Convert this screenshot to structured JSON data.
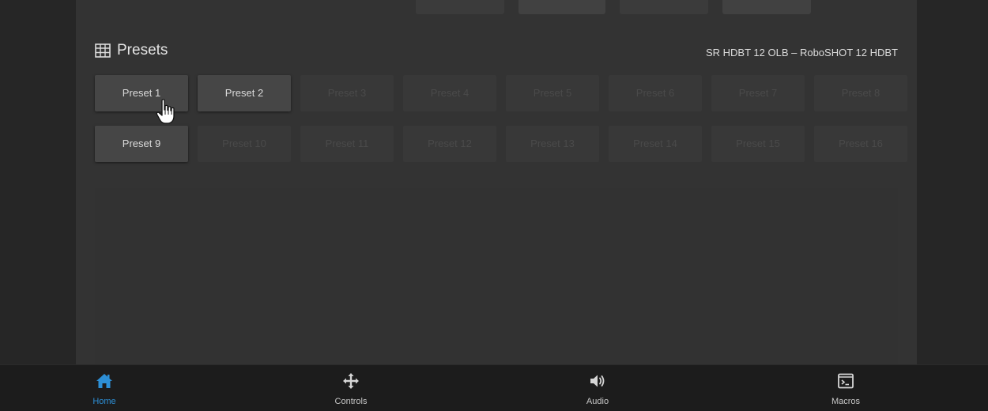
{
  "presets_section": {
    "title": "Presets",
    "camera_name": "SR HDBT 12 OLB – RoboSHOT 12 HDBT",
    "presets": [
      {
        "label": "Preset 1",
        "state": "active"
      },
      {
        "label": "Preset 2",
        "state": "active"
      },
      {
        "label": "Preset 3",
        "state": "inactive"
      },
      {
        "label": "Preset 4",
        "state": "inactive"
      },
      {
        "label": "Preset 5",
        "state": "inactive"
      },
      {
        "label": "Preset 6",
        "state": "inactive"
      },
      {
        "label": "Preset 7",
        "state": "inactive"
      },
      {
        "label": "Preset 8",
        "state": "inactive"
      },
      {
        "label": "Preset 9",
        "state": "active"
      },
      {
        "label": "Preset 10",
        "state": "inactive"
      },
      {
        "label": "Preset 11",
        "state": "inactive"
      },
      {
        "label": "Preset 12",
        "state": "inactive"
      },
      {
        "label": "Preset 13",
        "state": "inactive"
      },
      {
        "label": "Preset 14",
        "state": "inactive"
      },
      {
        "label": "Preset 15",
        "state": "inactive"
      },
      {
        "label": "Preset 16",
        "state": "inactive"
      }
    ]
  },
  "bottom_nav": {
    "items": [
      {
        "label": "Home",
        "icon": "home-icon",
        "selected": true
      },
      {
        "label": "Controls",
        "icon": "move-arrows-icon",
        "selected": false
      },
      {
        "label": "Audio",
        "icon": "speaker-icon",
        "selected": false
      },
      {
        "label": "Macros",
        "icon": "terminal-icon",
        "selected": false
      }
    ]
  },
  "colors": {
    "accent": "#2d8fd6",
    "background": "#222222",
    "panel": "#333333",
    "button_active": "#464646",
    "button_inactive": "#383838"
  }
}
